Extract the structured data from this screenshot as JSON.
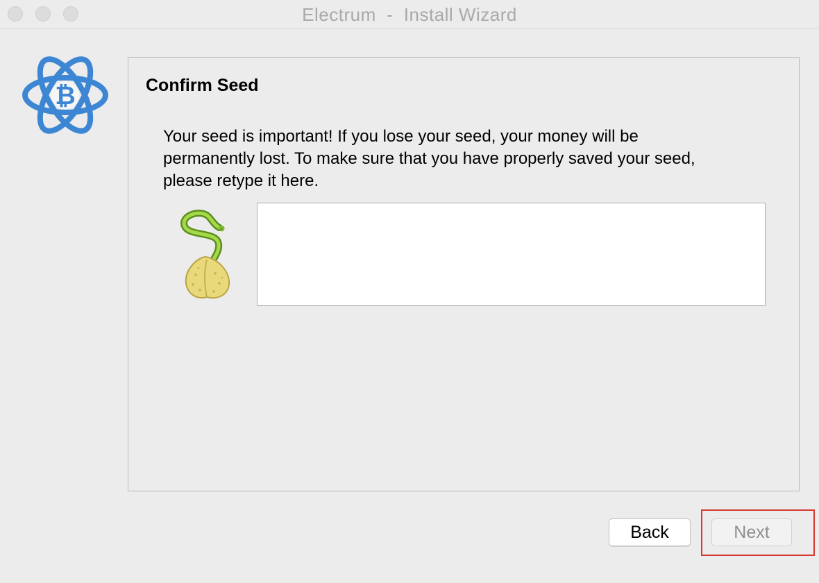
{
  "window": {
    "title": "Electrum  -  Install Wizard"
  },
  "wizard": {
    "heading": "Confirm Seed",
    "message": "Your seed is important! If you lose your seed, your money will be permanently lost. To make sure that you have properly saved your seed, please retype it here.",
    "seed_input": {
      "value": "",
      "placeholder": ""
    }
  },
  "buttons": {
    "back_label": "Back",
    "next_label": "Next",
    "next_enabled": false
  },
  "icons": {
    "logo": "electrum-bitcoin-atom-icon",
    "seed": "sprouting-seed-icon"
  },
  "colors": {
    "accent": "#3d86d4",
    "highlight": "#d33a32"
  }
}
